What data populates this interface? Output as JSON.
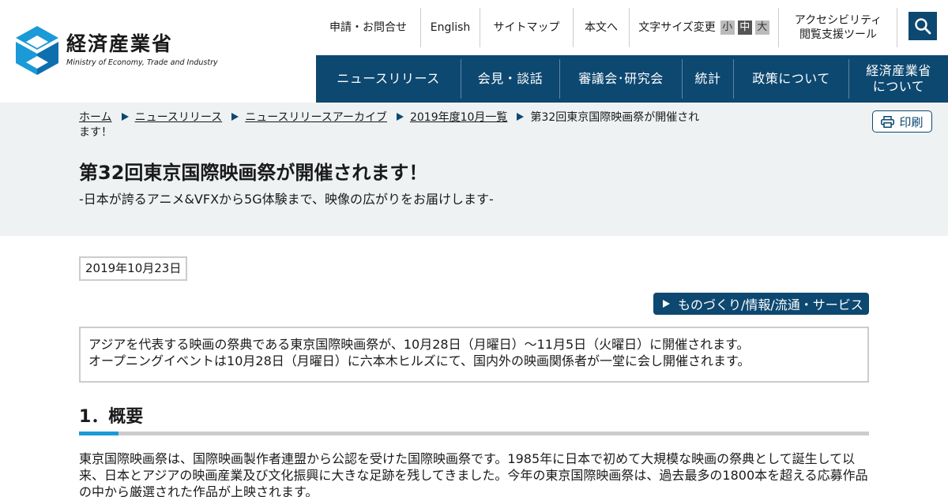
{
  "header": {
    "logo_jp": "経済産業省",
    "logo_en": "Ministry of Economy, Trade and Industry",
    "util": {
      "inquiry": "申請・お問合せ",
      "english": "English",
      "sitemap": "サイトマップ",
      "to_content": "本文へ",
      "font_size_label": "文字サイズ変更",
      "font_small": "小",
      "font_medium": "中",
      "font_large": "大",
      "accessibility_line1": "アクセシビリティ",
      "accessibility_line2": "閲覧支援ツール"
    },
    "search_icon": "search-icon",
    "colors": {
      "brand": "#0d4870",
      "accent": "#1a9ad6",
      "band": "#eef2f3"
    }
  },
  "gnav": {
    "news": "ニュースリリース",
    "press": "会見・談話",
    "council": "審議会･研究会",
    "stats": "統計",
    "policy": "政策について",
    "about_line1": "経済産業省",
    "about_line2": "について"
  },
  "breadcrumb": {
    "home": "ホーム",
    "news": "ニュースリリース",
    "archive": "ニュースリリースアーカイブ",
    "month": "2019年度10月一覧",
    "current": "第32回東京国際映画祭が開催されます！"
  },
  "print_label": "印刷",
  "article": {
    "title": "第32回東京国際映画祭が開催されます！",
    "subtitle": "-日本が誇るアニメ&VFXから5G体験まで、映像の広がりをお届けします-",
    "date": "2019年10月23日",
    "category": "ものづくり/情報/流通・サービス",
    "summary_line1": "アジアを代表する映画の祭典である東京国際映画祭が、10月28日（月曜日）～11月5日（火曜日）に開催されます。",
    "summary_line2": "オープニングイベントは10月28日（月曜日）に六本木ヒルズにて、国内外の映画関係者が一堂に会し開催されます。",
    "section1_heading": "1．概要",
    "section1_body": "東京国際映画祭は、国際映画製作者連盟から公認を受けた国際映画祭です。1985年に日本で初めて大規模な映画の祭典として誕生して以来、日本とアジアの映画産業及び文化振興に大きな足跡を残してきました。今年の東京国際映画祭は、過去最多の1800本を超える応募作品の中から厳選された作品が上映されます。"
  }
}
